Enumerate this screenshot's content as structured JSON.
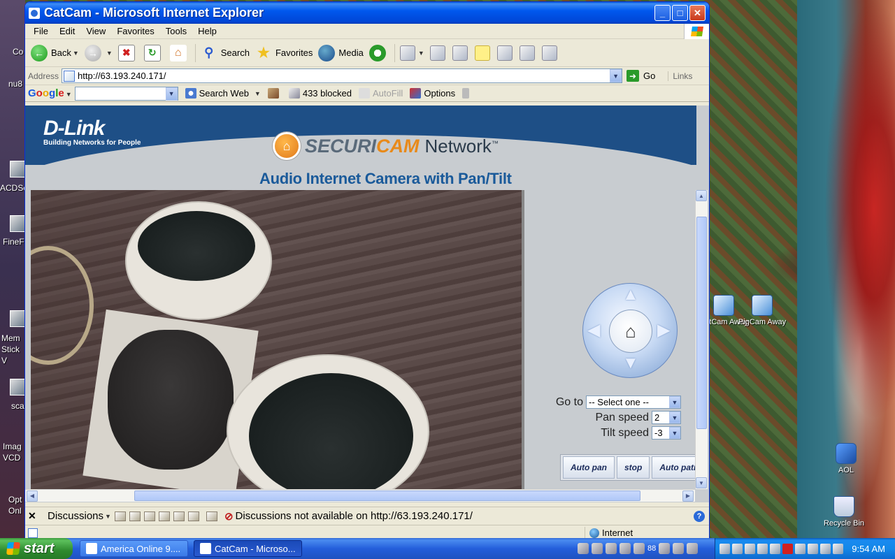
{
  "window": {
    "title": "CatCam - Microsoft Internet Explorer",
    "minimize": "_",
    "maximize": "□",
    "close": "✕"
  },
  "menu": [
    "File",
    "Edit",
    "View",
    "Favorites",
    "Tools",
    "Help"
  ],
  "toolbar": {
    "back_label": "Back",
    "search_label": "Search",
    "favorites_label": "Favorites",
    "media_label": "Media"
  },
  "address": {
    "label": "Address",
    "url": "http://63.193.240.171/",
    "go_label": "Go",
    "links_label": "Links"
  },
  "googlebar": {
    "logo": "Google",
    "search_web": "Search Web",
    "blocked": "433 blocked",
    "autofill": "AutoFill",
    "options": "Options"
  },
  "page": {
    "brand": "D-Link",
    "brand_tagline": "Building Networks for People",
    "product_securi": "SECURI",
    "product_cam": "CAM",
    "product_network": "Network",
    "product_tm": "™",
    "subtitle": "Audio Internet Camera with Pan/Tilt",
    "goto_label": "Go to",
    "goto_value": "-- Select one --",
    "pan_label": "Pan speed",
    "pan_value": "2",
    "tilt_label": "Tilt speed",
    "tilt_value": "-3",
    "buttons": [
      "Auto pan",
      "stop",
      "Auto patrol"
    ]
  },
  "discussions": {
    "label": "Discussions",
    "message": "Discussions not available on http://63.193.240.171/"
  },
  "status": {
    "zone": "Internet"
  },
  "desktop": {
    "icons": [
      {
        "label": "CatCam Away"
      },
      {
        "label": "PigCam Away"
      },
      {
        "label": "AOL"
      },
      {
        "label": "Recycle Bin"
      }
    ],
    "left_labels": [
      "Co",
      "nu8",
      "ACDSe",
      "FineF",
      "Mem Stick V",
      "sca",
      "Imag VCD",
      "Opt Onl"
    ]
  },
  "taskbar": {
    "start": "start",
    "tasks": [
      "America Online 9....",
      "CatCam - Microso..."
    ],
    "tray_count": "88",
    "clock": "9:54 AM"
  }
}
